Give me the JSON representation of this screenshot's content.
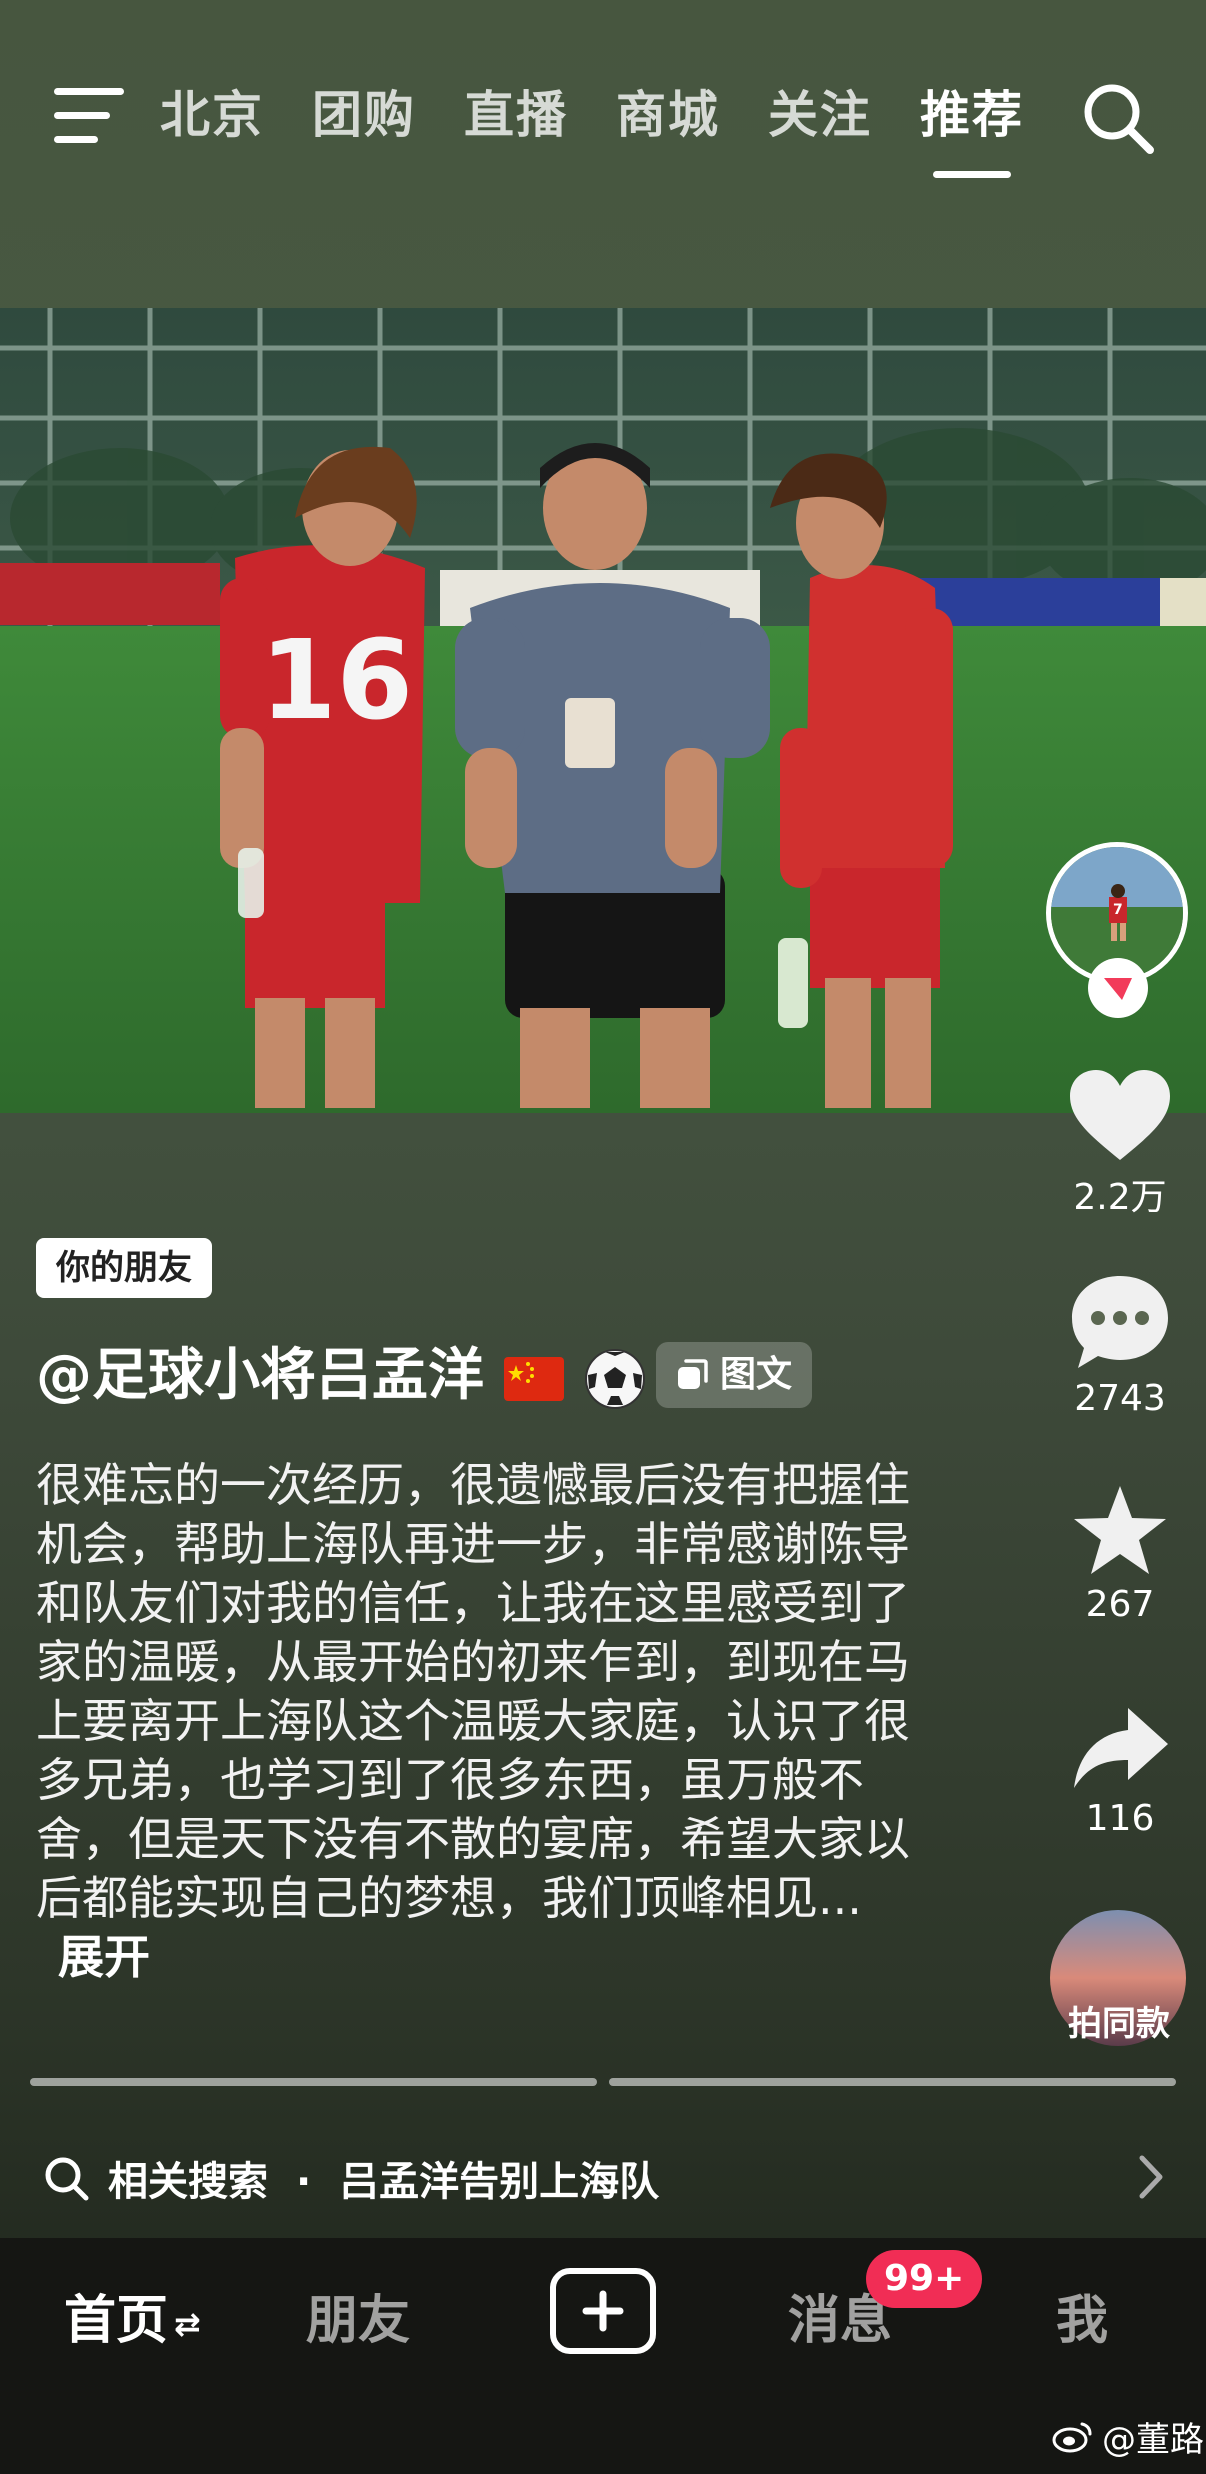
{
  "top_tabs": [
    "北京",
    "团购",
    "直播",
    "商城",
    "关注",
    "推荐"
  ],
  "active_tab": "推荐",
  "friend_tag": "你的朋友",
  "author": "@足球小将吕孟洋",
  "post_type_label": "图文",
  "description": "很难忘的一次经历，很遗憾最后没有把握住机会，帮助上海队再进一步，非常感谢陈导和队友们对我的信任，让我在这里感受到了家的温暖，从最开始的初来乍到，到现在马上要离开上海队这个温暖大家庭，认识了很多兄弟，也学习到了很多东西，虽万般不舍，但是天下没有不散的宴席，希望大家以后都能实现自己的梦想，我们顶峰相见...",
  "expand_label": "展开",
  "jersey_number": "16",
  "avatar_jersey_number": "7",
  "likes": "2.2万",
  "comments": "2743",
  "favorites": "267",
  "shares": "116",
  "music_label": "拍同款",
  "related_search": {
    "prefix": "相关搜索",
    "separator": "·",
    "query": "吕孟洋告别上海队"
  },
  "bottom_nav": {
    "home": "首页",
    "home_suffix": "⇄",
    "friends": "朋友",
    "messages": "消息",
    "messages_badge": "99+",
    "me": "我"
  },
  "watermark": "@董路",
  "colors": {
    "badge_red": "#f12d55",
    "bottom_nav_bg": "#151613",
    "follow_red": "#f23b5a"
  }
}
